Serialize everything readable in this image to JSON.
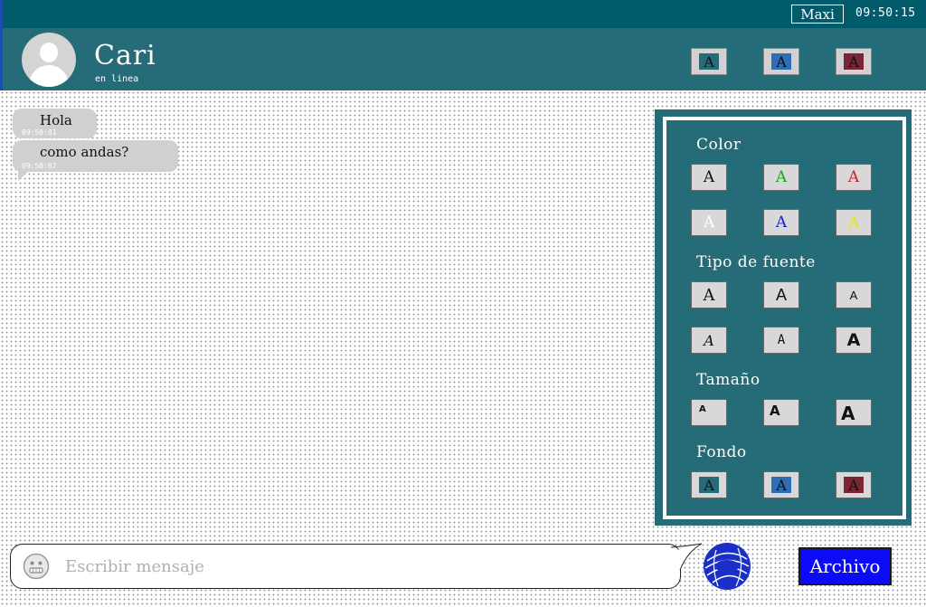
{
  "topbar": {
    "user": "Maxi",
    "clock": "09:50:15"
  },
  "header": {
    "contact_name": "Cari",
    "contact_status": "en linea"
  },
  "theme_buttons": [
    {
      "label": "A",
      "color": "#256b78"
    },
    {
      "label": "A",
      "color": "#2f6db5"
    },
    {
      "label": "A",
      "color": "#7a2436"
    }
  ],
  "messages": [
    {
      "text": "Hola",
      "time": "09:50:01"
    },
    {
      "text": "como andas?",
      "time": "09:50:07"
    }
  ],
  "panel": {
    "color_title": "Color",
    "color_options": [
      {
        "label": "A",
        "color": "#111111"
      },
      {
        "label": "A",
        "color": "#1aa51a"
      },
      {
        "label": "A",
        "color": "#d02020"
      },
      {
        "label": "A",
        "color": "#ffffff"
      },
      {
        "label": "A",
        "color": "#1a1ad0"
      },
      {
        "label": "A",
        "color": "#f0e020"
      }
    ],
    "font_title": "Tipo de fuente",
    "font_options": [
      "A",
      "A",
      "A",
      "A",
      "A",
      "A"
    ],
    "size_title": "Tamaño",
    "size_options": [
      "A",
      "A",
      "A"
    ],
    "background_title": "Fondo",
    "background_options": [
      {
        "label": "A",
        "color": "#256b78"
      },
      {
        "label": "A",
        "color": "#2f6db5"
      },
      {
        "label": "A",
        "color": "#7a2436"
      }
    ]
  },
  "composer": {
    "placeholder": "Escribir mensaje",
    "file_button": "Archivo"
  },
  "icons": {
    "avatar": "user-avatar-icon",
    "emoji": "smiley-icon",
    "send": "send-logo-icon"
  }
}
